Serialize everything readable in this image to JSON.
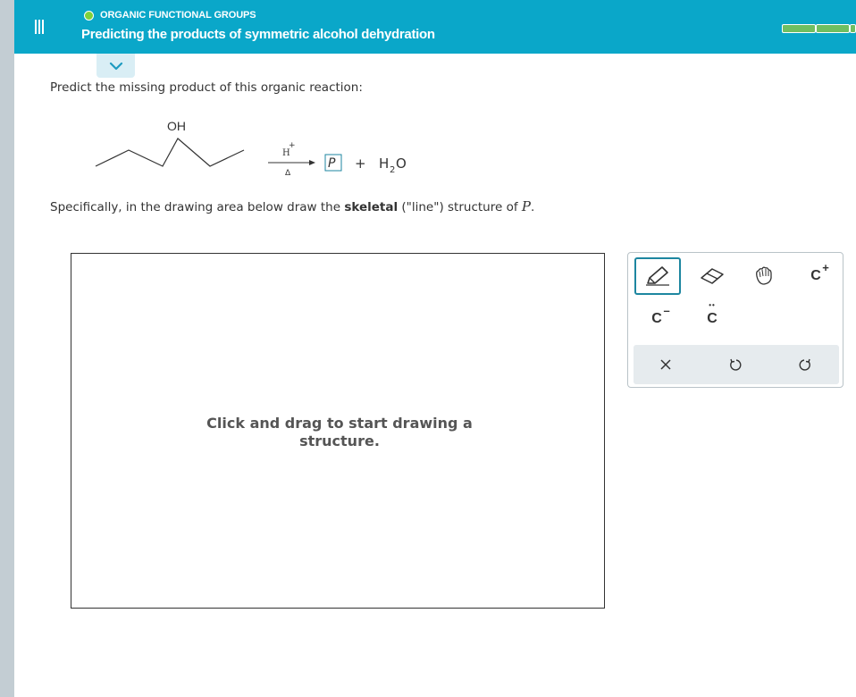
{
  "header": {
    "topic": "ORGANIC FUNCTIONAL GROUPS",
    "title": "Predicting the products of symmetric alcohol dehydration",
    "progress_segments": 2,
    "colors": {
      "bar": "#0aa7c9",
      "topic_dot": "#7fd13b",
      "progress": "#6fbf61"
    }
  },
  "question": {
    "prompt": "Predict the missing product of this organic reaction:",
    "reaction": {
      "reactant_label": "OH",
      "reagent_above": "H",
      "reagent_charge": "+",
      "reagent_below": "Δ",
      "product_box": "P",
      "plus": "+",
      "water_h": "H",
      "water_sub": "2",
      "water_o": "O"
    },
    "instruction_before": "Specifically, in the drawing area below draw the ",
    "instruction_bold": "skeletal",
    "instruction_after": " (\"line\") structure of ",
    "instruction_var": "P",
    "instruction_end": "."
  },
  "canvas": {
    "hint_line1": "Click and drag to start drawing a",
    "hint_line2": "structure."
  },
  "toolbox": {
    "selected_tool": "pencil",
    "tools": [
      {
        "name": "pencil",
        "icon": "pencil-icon"
      },
      {
        "name": "eraser",
        "icon": "eraser-icon"
      },
      {
        "name": "hand",
        "icon": "hand-icon"
      },
      {
        "name": "carbocation",
        "label": "C",
        "charge": "+"
      },
      {
        "name": "carbanion",
        "label": "C",
        "charge": "–"
      },
      {
        "name": "lone-pair-carbon",
        "label": "C",
        "dots": "••"
      }
    ],
    "actions": [
      {
        "name": "clear",
        "icon": "close-icon"
      },
      {
        "name": "undo",
        "icon": "undo-icon"
      },
      {
        "name": "redo",
        "icon": "redo-icon"
      }
    ]
  }
}
